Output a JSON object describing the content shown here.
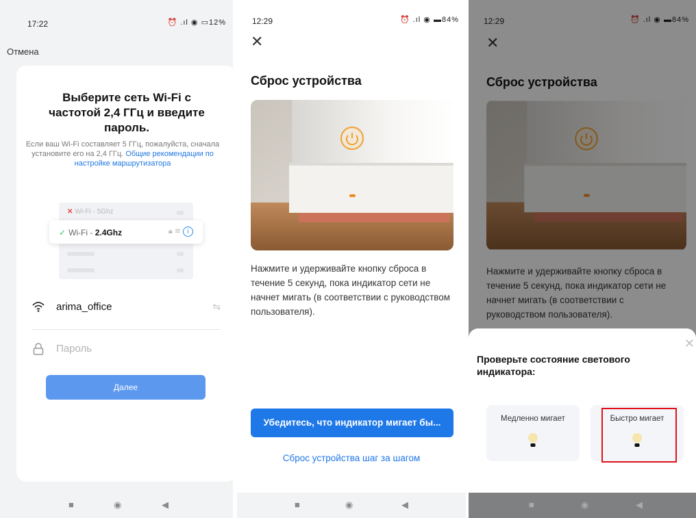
{
  "screen1": {
    "status": {
      "time": "17:22",
      "battery": "12"
    },
    "cancel_label": "Отмена",
    "title": "Выберите сеть Wi-Fi с частотой 2,4 ГГц и введите пароль.",
    "subtitle": "Если ваш Wi-Fi составляет 5 ГГц, пожалуйста, сначала установите его на 2,4 ГГц.",
    "subtitle_link": "Общие рекомендации по настройке маршрутизатора",
    "illustration": {
      "wifi5_label": "Wi-Fi - 5Ghz",
      "wifi24_prefix": "Wi-Fi - ",
      "wifi24_bold": "2.4Ghz"
    },
    "ssid": "arima_office",
    "password_placeholder": "Пароль",
    "next_label": "Далее"
  },
  "screen2": {
    "status": {
      "time": "12:29",
      "battery": "84"
    },
    "title": "Сброс устройства",
    "description": "Нажмите и удерживайте кнопку сброса в течение 5 секунд, пока индикатор сети не начнет мигать  (в соответствии с руководством пользователя).",
    "confirm_label": "Убедитесь, что индикатор мигает бы...",
    "step_link": "Сброс устройства шаг за шагом"
  },
  "screen3": {
    "status": {
      "time": "12:29",
      "battery": "84"
    },
    "title": "Сброс устройства",
    "description": "Нажмите и удерживайте кнопку сброса в течение 5 секунд, пока индикатор сети не начнет мигать  (в соответствии с руководством пользователя).",
    "sheet_title": "Проверьте состояние светового индикатора:",
    "options": [
      {
        "label": "Медленно мигает"
      },
      {
        "label": "Быстро мигает"
      }
    ],
    "highlighted_option": "Быстро мигает"
  },
  "colors": {
    "accent": "#1e78e8",
    "next_button": "#5c98ee",
    "highlight": "#e0101a",
    "led": "#f0a030"
  }
}
